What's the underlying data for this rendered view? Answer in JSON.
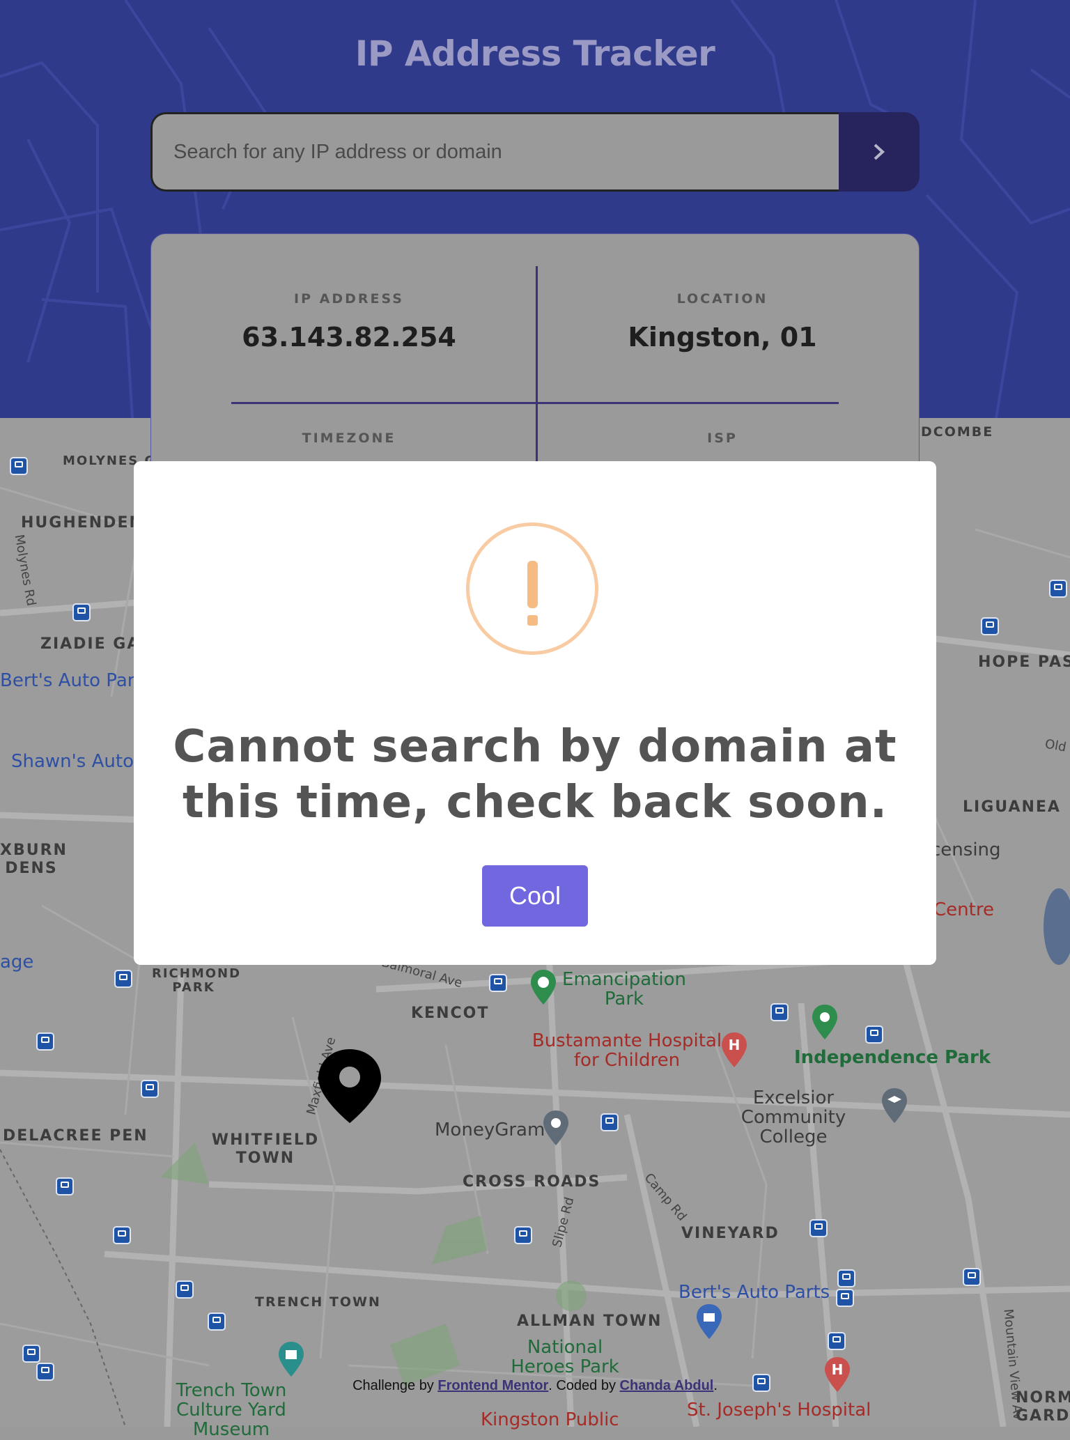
{
  "header": {
    "title": "IP Address Tracker",
    "background_color": "#303a8a"
  },
  "search": {
    "placeholder": "Search for any IP address or domain",
    "button_icon": "chevron-right-icon"
  },
  "info": {
    "ip_label": "IP ADDRESS",
    "ip_value": "63.143.82.254",
    "location_label": "LOCATION",
    "location_value": "Kingston, 01",
    "timezone_label": "TIMEZONE",
    "isp_label": "ISP"
  },
  "map": {
    "areas": [
      "MOLYNES GARDENS",
      "HUGHENDEN",
      "ZIADIE GA",
      "XBURN DENS",
      "RICHMOND PARK",
      "KENCOT",
      "DELACREE PEN",
      "WHITFIELD TOWN",
      "CROSS ROADS",
      "VINEYARD",
      "TRENCH TOWN",
      "ALLMAN TOWN",
      "HOPE PAS",
      "LIGUANEA",
      "DCOMBE",
      "NORM GARD"
    ],
    "places": [
      "Bert's Auto Parts",
      "Shawn's Auto",
      "age",
      "Emancipation Park",
      "Bustamante Hospital for Children",
      "Independence Park",
      "Excelsior Community College",
      "MoneyGram",
      "Bert's Auto Parts",
      "National Heroes Park",
      "Trench Town Culture Yard Museum",
      "Kingston Public",
      "St. Joseph's Hospital",
      "censing",
      "Centre"
    ],
    "roads": [
      "Molynes Rd",
      "Balmoral Ave",
      "Maxfield Ave",
      "Camp Rd",
      "Slipe Rd",
      "Old",
      "Mountain View Av"
    ]
  },
  "modal": {
    "icon": "warning-icon",
    "message": "Cannot search by domain at this time, check back soon.",
    "button_label": "Cool",
    "button_color": "#7167de",
    "icon_color": "#f8cba3"
  },
  "footer": {
    "prefix": "Challenge by ",
    "link1": "Frontend Mentor",
    "middle": ". Coded by ",
    "link2": "Chanda Abdul",
    "suffix": "."
  }
}
